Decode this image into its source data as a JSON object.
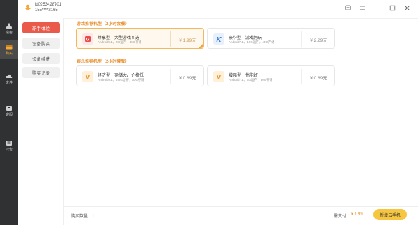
{
  "account": {
    "id": "ld0953428701",
    "phone": "155****2165"
  },
  "rail": [
    {
      "label": "设备",
      "icon": "device-icon"
    },
    {
      "label": "购买",
      "icon": "purchase-icon"
    },
    {
      "label": "文件",
      "icon": "file-icon"
    },
    {
      "label": "客服",
      "icon": "service-icon"
    },
    {
      "label": "公告",
      "icon": "announcement-icon"
    }
  ],
  "menu": [
    {
      "label": "新手体验"
    },
    {
      "label": "设备购买"
    },
    {
      "label": "设备续费"
    },
    {
      "label": "购买记录"
    }
  ],
  "sections": {
    "game": {
      "title": "游戏推荐机型（2小时套餐）",
      "cards": [
        {
          "title": "尊享型，大型游戏首选",
          "spec": "Android9.1，4G运存，45G存储",
          "price": "¥ 1.99元",
          "icon": "google-play-icon"
        },
        {
          "title": "豪华型，游戏畅玩",
          "spec": "Android7.1，10G运存，45G存储",
          "price": "¥ 2.29元",
          "icon": "k-app-icon"
        }
      ]
    },
    "office": {
      "title": "娱乐推荐机型（2小时套餐）",
      "cards": [
        {
          "title": "经济型，存储大，价格低",
          "spec": "Android9.1，2.5G运存，30G存储",
          "price": "¥ 0.89元",
          "icon": "v-app-icon"
        },
        {
          "title": "增强型，性能好",
          "spec": "Android7.1，5G运存，30G存储",
          "price": "¥ 0.89元",
          "icon": "v-app-icon"
        }
      ]
    }
  },
  "bottom": {
    "qty_label": "购买数量：1",
    "need_label": "需支付：",
    "need_value": "¥ 1.99",
    "add_button": "新增云手机"
  },
  "colors": {
    "accent_orange": "#e8902e",
    "primary_red": "#ea5a4a",
    "rail_dark": "#2f3133",
    "button_yellow": "#f6c640"
  }
}
